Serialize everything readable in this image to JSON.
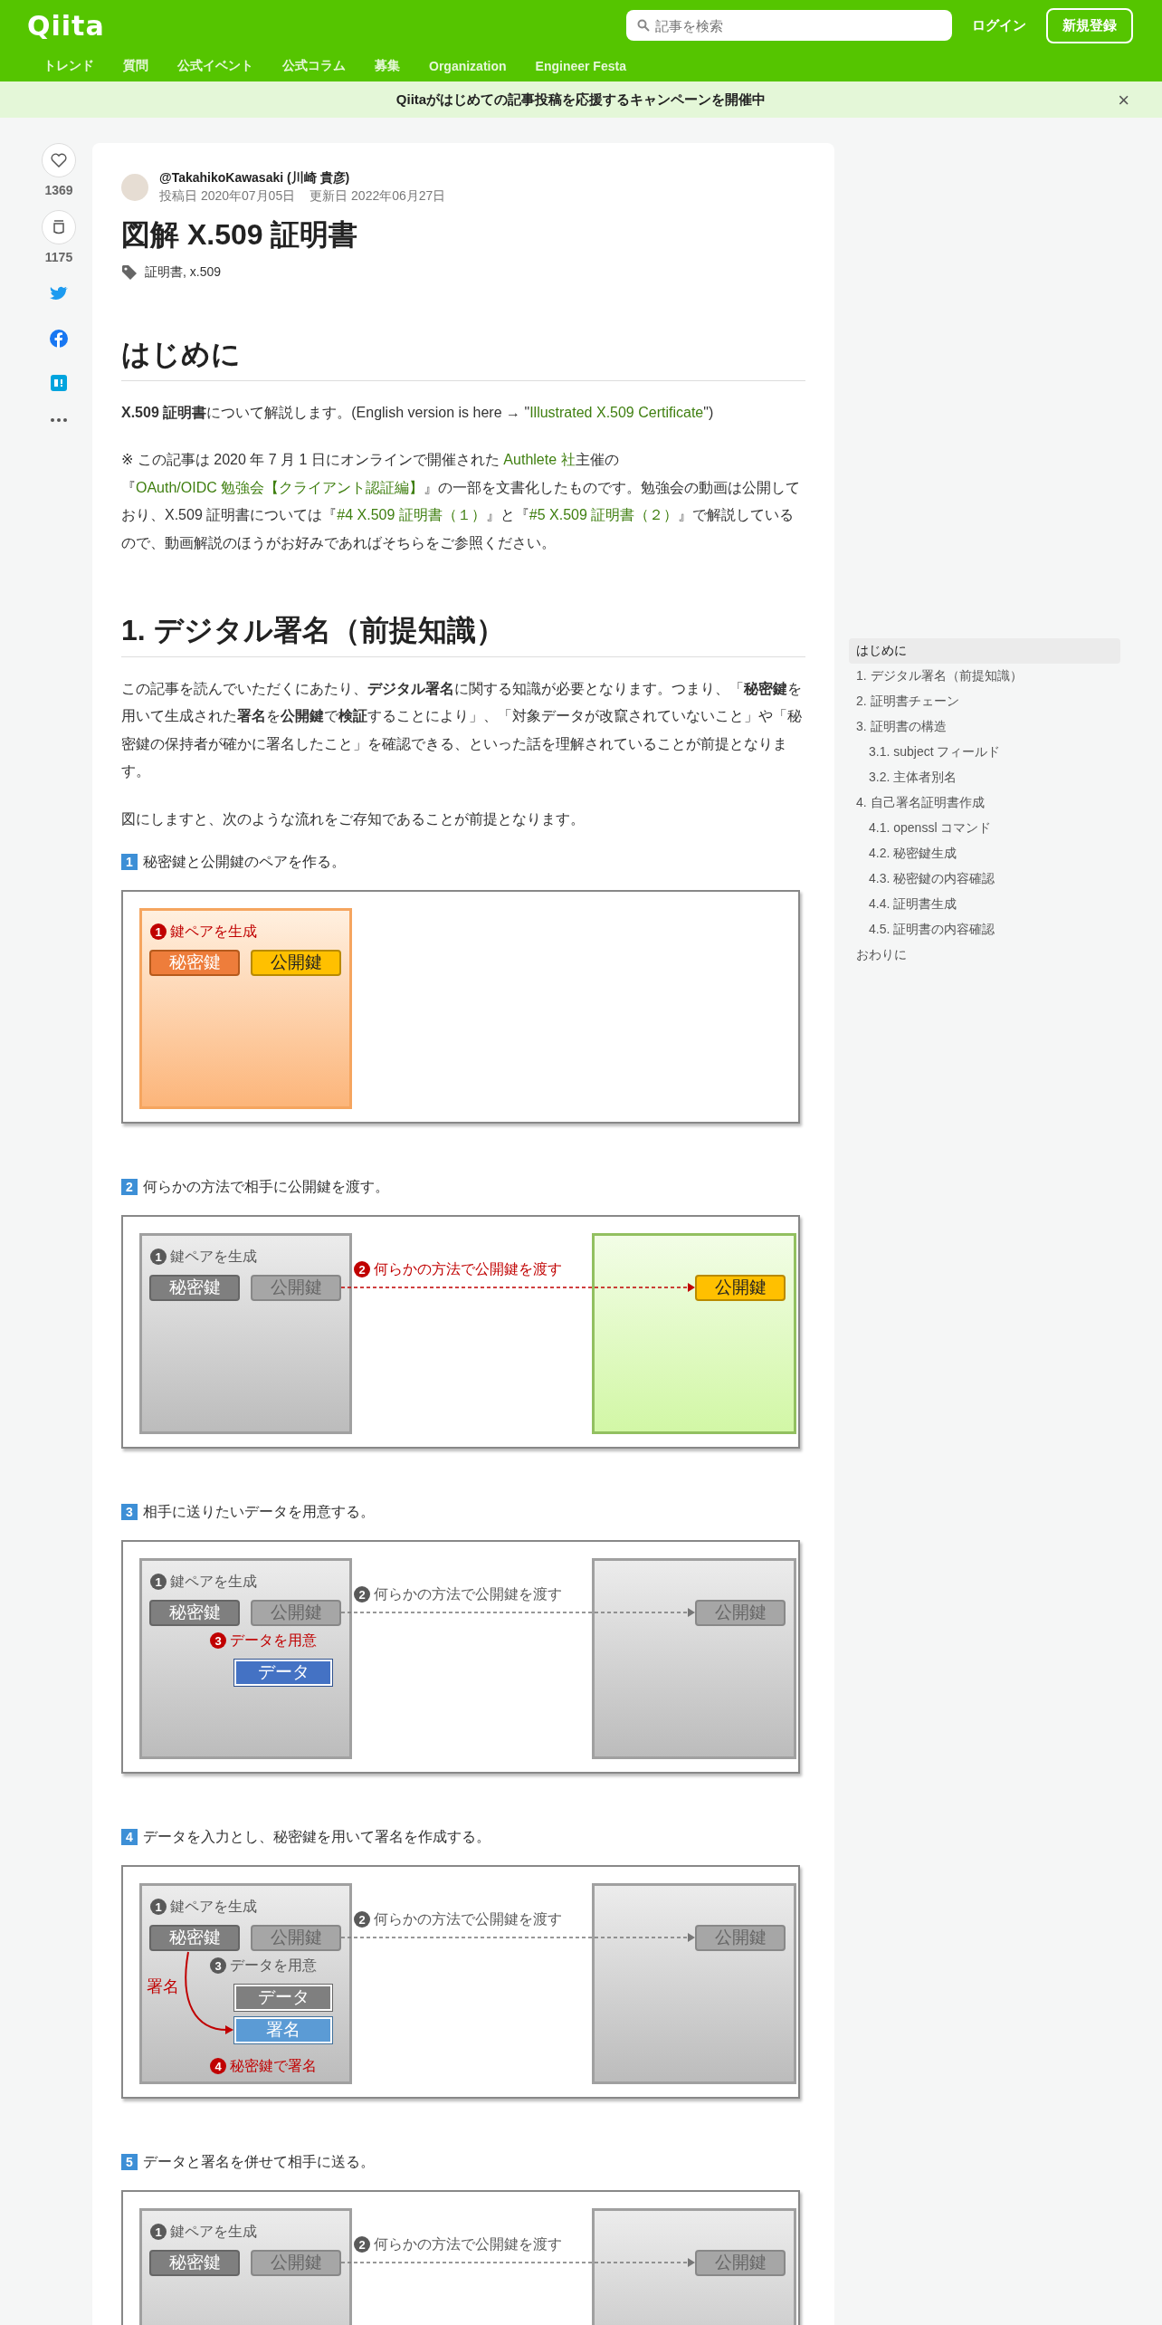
{
  "header": {
    "logo": "Qiita",
    "search": {
      "placeholder": "記事を検索"
    },
    "login": "ログイン",
    "signup": "新規登録",
    "nav": [
      "トレンド",
      "質問",
      "公式イベント",
      "公式コラム",
      "募集",
      "Organization",
      "Engineer Festa"
    ]
  },
  "banner": {
    "text": "Qiitaがはじめての記事投稿を応援するキャンペーンを開催中",
    "close": "×"
  },
  "actions": {
    "likes": "1369",
    "stocks": "1175"
  },
  "article": {
    "author": "@TakahikoKawasaki (川崎 貴彦)",
    "posted": "投稿日 2020年07月05日",
    "updated": "更新日 2022年06月27日",
    "title": "図解 X.509 証明書",
    "tags": [
      "証明書",
      ", ",
      "x.509"
    ],
    "body": [
      {
        "kind": "heading",
        "text": "はじめに"
      },
      {
        "kind": "paragraph",
        "segments": [
          {
            "kind": "bold",
            "text": "X.509 証明書"
          },
          {
            "kind": "text",
            "text": "について解説します。(English version is here → \""
          },
          {
            "kind": "link",
            "text": "Illustrated X.509 Certificate"
          },
          {
            "kind": "text",
            "text": "\")"
          }
        ]
      },
      {
        "kind": "paragraph",
        "segments": [
          {
            "kind": "text",
            "text": "※ この記事は 2020 年 7 月 1 日にオンラインで開催された "
          },
          {
            "kind": "link",
            "text": "Authlete 社"
          },
          {
            "kind": "text",
            "text": "主催の『"
          },
          {
            "kind": "link",
            "text": "OAuth/OIDC 勉強会【クライアント認証編】"
          },
          {
            "kind": "text",
            "text": "』の一部を文書化したものです。勉強会の動画は公開しており、X.509 証明書については『"
          },
          {
            "kind": "link",
            "text": "#4 X.509 証明書（１）"
          },
          {
            "kind": "text",
            "text": "』と『"
          },
          {
            "kind": "link",
            "text": "#5 X.509 証明書（２）"
          },
          {
            "kind": "text",
            "text": "』で解説しているので、動画解説のほうがお好みであればそちらをご参照ください。"
          }
        ]
      },
      {
        "kind": "heading",
        "text": "1. デジタル署名（前提知識）"
      },
      {
        "kind": "paragraph",
        "segments": [
          {
            "kind": "text",
            "text": "この記事を読んでいただくにあたり、"
          },
          {
            "kind": "bold",
            "text": "デジタル署名"
          },
          {
            "kind": "text",
            "text": "に関する知識が必要となります。つまり、「"
          },
          {
            "kind": "bold",
            "text": "秘密鍵"
          },
          {
            "kind": "text",
            "text": "を用いて生成された"
          },
          {
            "kind": "bold",
            "text": "署名"
          },
          {
            "kind": "text",
            "text": "を"
          },
          {
            "kind": "bold",
            "text": "公開鍵"
          },
          {
            "kind": "text",
            "text": "で"
          },
          {
            "kind": "bold",
            "text": "検証"
          },
          {
            "kind": "text",
            "text": "することにより」、「対象データが改竄されていないこと」や「秘密鍵の保持者が確かに署名したこと」を確認できる、といった話を理解されていることが前提となります。"
          }
        ]
      },
      {
        "kind": "paragraph",
        "segments": [
          {
            "kind": "text",
            "text": "図にしますと、次のような流れをご存知であることが前提となります。"
          }
        ]
      },
      {
        "kind": "step",
        "number": "1",
        "caption": "秘密鍵と公開鍵のペアを作る。",
        "figure": {
          "left_highlighted": true,
          "gen": {
            "number": "1",
            "label": "鍵ペアを生成",
            "active": true
          },
          "keys": [
            {
              "kind": "private",
              "label": "秘密鍵",
              "active": true
            },
            {
              "kind": "public",
              "label": "公開鍵",
              "active": true
            }
          ]
        }
      },
      {
        "kind": "step",
        "number": "2",
        "caption": "何らかの方法で相手に公開鍵を渡す。",
        "figure": {
          "left_highlighted": false,
          "gen": {
            "number": "1",
            "label": "鍵ペアを生成",
            "active": false
          },
          "keys": [
            {
              "kind": "private",
              "label": "秘密鍵",
              "active": false
            },
            {
              "kind": "public",
              "label": "公開鍵",
              "active": false
            }
          ],
          "transfer": {
            "number": "2",
            "label": "何らかの方法で公開鍵を渡す",
            "active": true
          },
          "right": {
            "highlighted": true,
            "key": {
              "label": "公開鍵",
              "active": true
            }
          }
        }
      },
      {
        "kind": "step",
        "number": "3",
        "caption": "相手に送りたいデータを用意する。",
        "figure": {
          "left_highlighted": false,
          "gen": {
            "number": "1",
            "label": "鍵ペアを生成",
            "active": false
          },
          "keys": [
            {
              "kind": "private",
              "label": "秘密鍵",
              "active": false
            },
            {
              "kind": "public",
              "label": "公開鍵",
              "active": false
            }
          ],
          "transfer": {
            "number": "2",
            "label": "何らかの方法で公開鍵を渡す",
            "active": false
          },
          "right": {
            "highlighted": false,
            "key": {
              "label": "公開鍵",
              "active": false
            }
          },
          "data_step": {
            "number": "3",
            "label": "データを用意",
            "active": true
          },
          "data": {
            "label": "データ",
            "active": true
          }
        }
      },
      {
        "kind": "step",
        "number": "4",
        "caption": "データを入力とし、秘密鍵を用いて署名を作成する。",
        "figure": {
          "left_highlighted": false,
          "gen": {
            "number": "1",
            "label": "鍵ペアを生成",
            "active": false
          },
          "keys": [
            {
              "kind": "private",
              "label": "秘密鍵",
              "active": false
            },
            {
              "kind": "public",
              "label": "公開鍵",
              "active": false
            }
          ],
          "transfer": {
            "number": "2",
            "label": "何らかの方法で公開鍵を渡す",
            "active": false
          },
          "right": {
            "highlighted": false,
            "key": {
              "label": "公開鍵",
              "active": false
            }
          },
          "data_step": {
            "number": "3",
            "label": "データを用意",
            "active": false
          },
          "data": {
            "label": "データ",
            "active": false
          },
          "signing": {
            "arrow_label": "署名",
            "signature": "署名",
            "step_number": "4",
            "step_label": "秘密鍵で署名"
          }
        }
      },
      {
        "kind": "step",
        "number": "5",
        "caption": "データと署名を併せて相手に送る。",
        "figure": {
          "left_highlighted": false,
          "gen": {
            "number": "1",
            "label": "鍵ペアを生成",
            "active": false
          },
          "keys": [
            {
              "kind": "private",
              "label": "秘密鍵",
              "active": false
            },
            {
              "kind": "public",
              "label": "公開鍵",
              "active": false
            }
          ],
          "transfer": {
            "number": "2",
            "label": "何らかの方法で公開鍵を渡す",
            "active": false
          },
          "right": {
            "highlighted": false,
            "key": {
              "label": "公開鍵",
              "active": false
            }
          }
        }
      }
    ]
  },
  "toc": [
    {
      "label": "はじめに",
      "selected": true
    },
    {
      "label": "1. デジタル署名（前提知識）",
      "selected": false
    },
    {
      "label": "2. 証明書チェーン",
      "selected": false
    },
    {
      "label": "3. 証明書の構造",
      "selected": false,
      "children": [
        {
          "label": "3.1. subject フィールド",
          "selected": false
        },
        {
          "label": "3.2. 主体者別名",
          "selected": false
        }
      ]
    },
    {
      "label": "4. 自己署名証明書作成",
      "selected": false,
      "children": [
        {
          "label": "4.1. openssl コマンド",
          "selected": false
        },
        {
          "label": "4.2. 秘密鍵生成",
          "selected": false
        },
        {
          "label": "4.3. 秘密鍵の内容確認",
          "selected": false
        },
        {
          "label": "4.4. 証明書生成",
          "selected": false
        },
        {
          "label": "4.5. 証明書の内容確認",
          "selected": false
        }
      ]
    },
    {
      "label": "おわりに",
      "selected": false
    }
  ]
}
